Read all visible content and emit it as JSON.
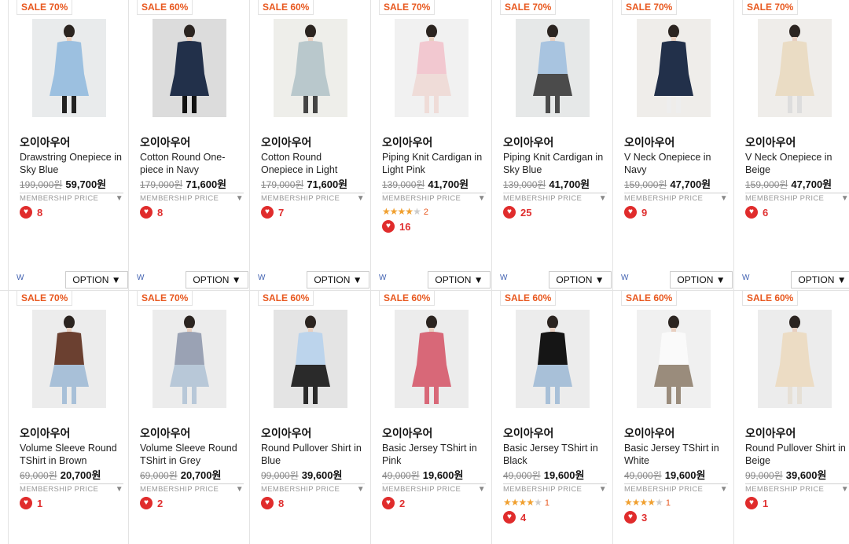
{
  "products": [
    {
      "sale": "SALE 70%",
      "brand": "오이아우어",
      "name": "Drawstring Onepiece in Sky Blue",
      "orig": "199,000원",
      "price": "59,700원",
      "member": "MEMBERSHIP PRICE",
      "likes": "8",
      "stars": null,
      "w": "W",
      "option": "OPTION ▼",
      "img": {
        "bg": "#e9ebec",
        "top": "#9cc0e0",
        "bottom": "#9cc0e0",
        "leg": "#222"
      }
    },
    {
      "sale": "SALE 60%",
      "brand": "오이아우어",
      "name": "Cotton Round One-piece in Navy",
      "orig": "179,000원",
      "price": "71,600원",
      "member": "MEMBERSHIP PRICE",
      "likes": "8",
      "stars": null,
      "w": "W",
      "option": "OPTION ▼",
      "img": {
        "bg": "#dcdcdc",
        "top": "#22304a",
        "bottom": "#22304a",
        "leg": "#111"
      }
    },
    {
      "sale": "SALE 60%",
      "brand": "오이아우어",
      "name": "Cotton Round Onepiece in Light",
      "orig": "179,000원",
      "price": "71,600원",
      "member": "MEMBERSHIP PRICE",
      "likes": "7",
      "stars": null,
      "w": "W",
      "option": "OPTION ▼",
      "img": {
        "bg": "#eeeeea",
        "top": "#b9c8cc",
        "bottom": "#b9c8cc",
        "leg": "#444"
      }
    },
    {
      "sale": "SALE 70%",
      "brand": "오이아우어",
      "name": "Piping Knit Cardigan in Light Pink",
      "orig": "139,000원",
      "price": "41,700원",
      "member": "MEMBERSHIP PRICE",
      "likes": "16",
      "stars": {
        "on": 4,
        "off": 1,
        "count": "2"
      },
      "w": "W",
      "option": "OPTION ▼",
      "img": {
        "bg": "#f1f1f1",
        "top": "#f2c8d0",
        "bottom": "#efdcd8",
        "leg": "#efdcd8"
      }
    },
    {
      "sale": "SALE 70%",
      "brand": "오이아우어",
      "name": "Piping Knit Cardigan in Sky Blue",
      "orig": "139,000원",
      "price": "41,700원",
      "member": "MEMBERSHIP PRICE",
      "likes": "25",
      "stars": null,
      "w": "W",
      "option": "OPTION ▼",
      "img": {
        "bg": "#e6e8e8",
        "top": "#a8c4e0",
        "bottom": "#4b4b4b",
        "leg": "#4b4b4b"
      }
    },
    {
      "sale": "SALE 70%",
      "brand": "오이아우어",
      "name": "V Neck Onepiece in Navy",
      "orig": "159,000원",
      "price": "47,700원",
      "member": "MEMBERSHIP PRICE",
      "likes": "9",
      "stars": null,
      "w": "W",
      "option": "OPTION ▼",
      "img": {
        "bg": "#efedea",
        "top": "#22304a",
        "bottom": "#22304a",
        "leg": "#eee"
      }
    },
    {
      "sale": "SALE 70%",
      "brand": "오이아우어",
      "name": "V Neck Onepiece in Beige",
      "orig": "159,000원",
      "price": "47,700원",
      "member": "MEMBERSHIP PRICE",
      "likes": "6",
      "stars": null,
      "w": "W",
      "option": "OPTION ▼",
      "img": {
        "bg": "#efedea",
        "top": "#eadcc4",
        "bottom": "#eadcc4",
        "leg": "#ddd"
      }
    },
    {
      "sale": "SALE 70%",
      "brand": "오이아우어",
      "name": "Volume Sleeve Round TShirt in Brown",
      "orig": "69,000원",
      "price": "20,700원",
      "member": "MEMBERSHIP PRICE",
      "likes": "1",
      "stars": null,
      "img": {
        "bg": "#ececec",
        "top": "#6b4030",
        "bottom": "#a8c0d8",
        "leg": "#a8c0d8"
      }
    },
    {
      "sale": "SALE 70%",
      "brand": "오이아우어",
      "name": "Volume Sleeve Round TShirt in Grey",
      "orig": "69,000원",
      "price": "20,700원",
      "member": "MEMBERSHIP PRICE",
      "likes": "2",
      "stars": null,
      "img": {
        "bg": "#ececec",
        "top": "#9aa2b4",
        "bottom": "#b8c8d8",
        "leg": "#b8c8d8"
      }
    },
    {
      "sale": "SALE 60%",
      "brand": "오이아우어",
      "name": "Round Pullover Shirt in Blue",
      "orig": "99,000원",
      "price": "39,600원",
      "member": "MEMBERSHIP PRICE",
      "likes": "8",
      "stars": null,
      "img": {
        "bg": "#e4e4e4",
        "top": "#bcd4ec",
        "bottom": "#2a2a2a",
        "leg": "#2a2a2a"
      }
    },
    {
      "sale": "SALE 60%",
      "brand": "오이아우어",
      "name": "Basic Jersey TShirt in Pink",
      "orig": "49,000원",
      "price": "19,600원",
      "member": "MEMBERSHIP PRICE",
      "likes": "2",
      "stars": null,
      "img": {
        "bg": "#ececec",
        "top": "#d86878",
        "bottom": "#d86878",
        "leg": "#d86878"
      }
    },
    {
      "sale": "SALE 60%",
      "brand": "오이아우어",
      "name": "Basic Jersey TShirt in Black",
      "orig": "49,000원",
      "price": "19,600원",
      "member": "MEMBERSHIP PRICE",
      "likes": "4",
      "stars": {
        "on": 4,
        "off": 1,
        "count": "1"
      },
      "img": {
        "bg": "#ececec",
        "top": "#151515",
        "bottom": "#a8c0d8",
        "leg": "#a8c0d8"
      }
    },
    {
      "sale": "SALE 60%",
      "brand": "오이아우어",
      "name": "Basic Jersey TShirt in White",
      "orig": "49,000원",
      "price": "19,600원",
      "member": "MEMBERSHIP PRICE",
      "likes": "3",
      "stars": {
        "on": 4,
        "off": 1,
        "count": "1"
      },
      "img": {
        "bg": "#f0f0f0",
        "top": "#fafafa",
        "bottom": "#9a8c7c",
        "leg": "#9a8c7c"
      }
    },
    {
      "sale": "SALE 60%",
      "brand": "오이아우어",
      "name": "Round Pullover Shirt in Beige",
      "orig": "99,000원",
      "price": "39,600원",
      "member": "MEMBERSHIP PRICE",
      "likes": "1",
      "stars": null,
      "img": {
        "bg": "#ececec",
        "top": "#ecdcc4",
        "bottom": "#ecdcc4",
        "leg": "#e6e0d6"
      }
    }
  ]
}
